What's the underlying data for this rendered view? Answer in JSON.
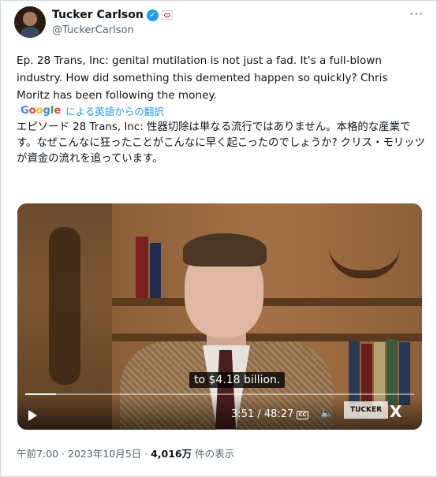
{
  "author": {
    "display_name": "Tucker Carlson",
    "handle": "@TuckerCarlson"
  },
  "tweet": {
    "text": "Ep. 28  Trans, Inc: genital mutilation is not just a fad. It's a full-blown industry. How did something this demented happen so quickly? Chris Moritz has been following the money.",
    "translate_link": "による英語からの翻訳",
    "translated_text": "エピソード 28 Trans, Inc: 性器切除は単なる流行ではありません。本格的な産業です。なぜこんなに狂ったことがこんなに早く起こったのでしょうか? クリス・モリッツが資金の流れを追っています。"
  },
  "google_logo": {
    "g1": "G",
    "o1": "o",
    "o2": "o",
    "g2": "g",
    "l": "l",
    "e": "e"
  },
  "video": {
    "caption": "to $4.18 billion.",
    "time": "3:51 / 48:27",
    "progress": 0.08,
    "watermark": "TUCKER",
    "cc_label": "CC"
  },
  "meta": {
    "timestamp": "午前7:00 · 2023年10月5日 · ",
    "views": "4,016万",
    "views_suffix": " 件の表示"
  },
  "colors": {
    "verified": "#1d9bf0",
    "link": "#1d9bf0",
    "secondary_text": "#536471"
  }
}
